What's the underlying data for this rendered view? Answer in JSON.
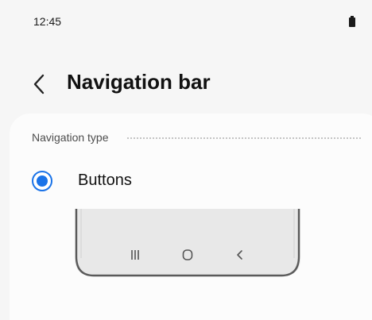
{
  "status_bar": {
    "time": "12:45",
    "battery_icon": "battery-icon"
  },
  "app_bar": {
    "back_icon": "chevron-left-icon",
    "title": "Navigation bar"
  },
  "navigation_type": {
    "header": "Navigation type",
    "options": [
      {
        "label": "Buttons",
        "selected": true
      }
    ]
  },
  "preview": {
    "keys": [
      "recent-apps-icon",
      "home-icon",
      "back-icon"
    ]
  },
  "colors": {
    "accent": "#1a73e8",
    "background": "#f6f6f6",
    "card": "#fcfcfc"
  }
}
